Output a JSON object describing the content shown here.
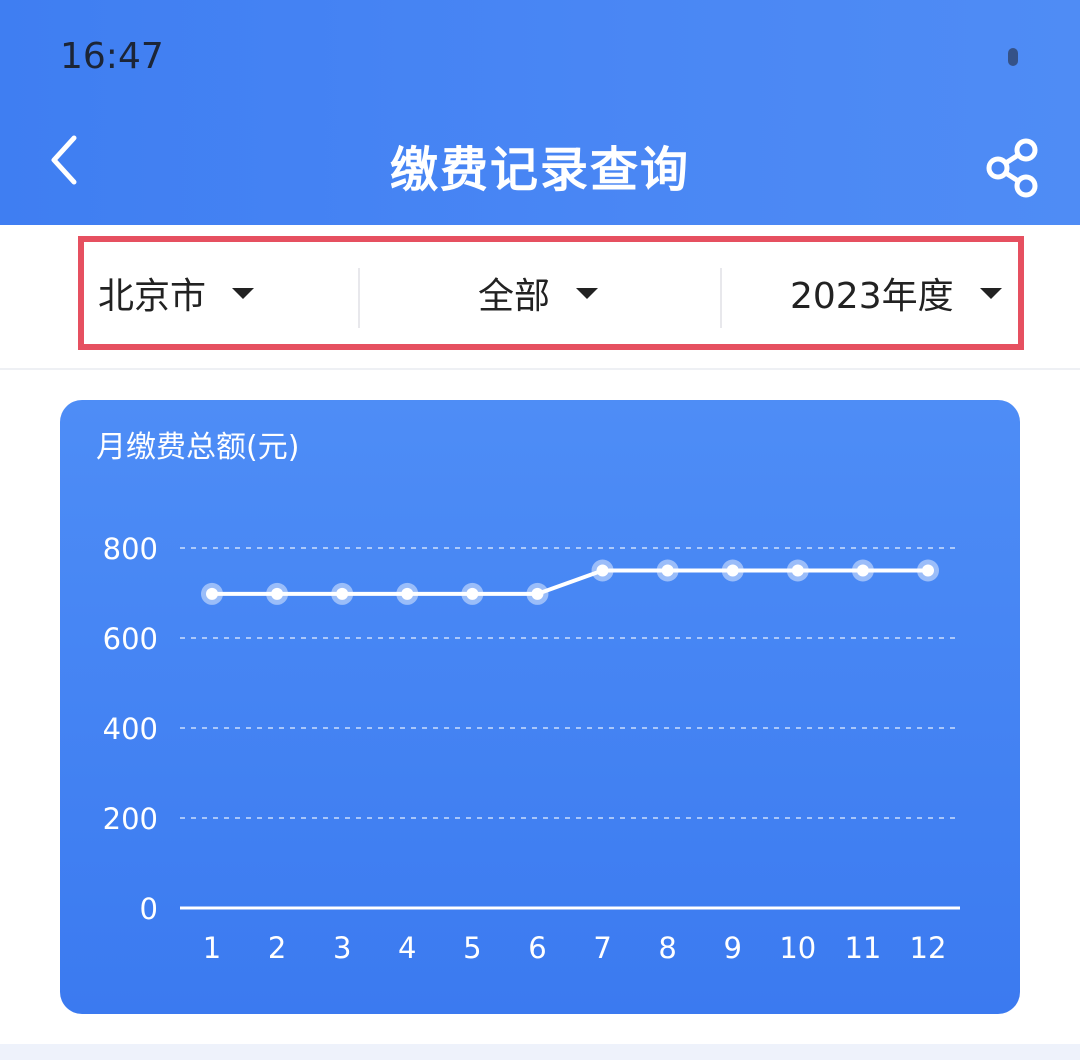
{
  "status_bar": {
    "time": "16:47"
  },
  "header": {
    "title": "缴费记录查询",
    "back_icon": "chevron-left-icon",
    "share_icon": "share-icon"
  },
  "filters": [
    {
      "label": "北京市"
    },
    {
      "label": "全部"
    },
    {
      "label": "2023年度"
    }
  ],
  "colors": {
    "header_blue": "#4585f3",
    "card_blue": "#4584f4",
    "highlight_border": "#e65060"
  },
  "chart_data": {
    "type": "line",
    "title": "月缴费总额(元)",
    "categories": [
      "1",
      "2",
      "3",
      "4",
      "5",
      "6",
      "7",
      "8",
      "9",
      "10",
      "11",
      "12"
    ],
    "series": [
      {
        "values": [
          698,
          698,
          698,
          698,
          698,
          698,
          750,
          750,
          750,
          750,
          750,
          750
        ]
      }
    ],
    "yticks": [
      0,
      200,
      400,
      600,
      800
    ],
    "ylim": [
      0,
      800
    ],
    "grid": true
  }
}
